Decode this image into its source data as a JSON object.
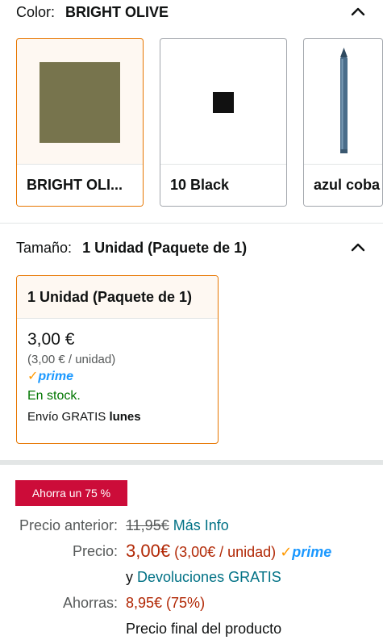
{
  "color_section": {
    "label": "Color:",
    "selected_value": "BRIGHT OLIVE",
    "swatches": [
      {
        "name": "BRIGHT OLI...",
        "color": "#77744d"
      },
      {
        "name": "10 Black",
        "color": "#111111"
      },
      {
        "name": "azul coba",
        "color": "#4a6d8a"
      }
    ]
  },
  "size_section": {
    "label": "Tamaño:",
    "selected_value": "1 Unidad (Paquete de 1)",
    "card": {
      "title": "1 Unidad (Paquete de 1)",
      "price": "3,00 €",
      "unit_price": "(3,00 € / unidad)",
      "prime": "prime",
      "stock": "En stock.",
      "shipping_prefix": "Envío GRATIS",
      "shipping_day": "lunes"
    }
  },
  "deal_badge": "Ahorra un 75 %",
  "pricing": {
    "previous_label": "Precio anterior:",
    "previous_price": "11,95€",
    "more_info": "Más Info",
    "price_label": "Precio:",
    "price": "3,00€",
    "price_unit": "(3,00€ / unidad)",
    "prime": "prime",
    "returns_prefix": "y",
    "returns_link": "Devoluciones GRATIS",
    "savings_label": "Ahorras:",
    "savings": "8,95€ (75%)",
    "final_note": "Precio final del producto"
  },
  "colors": {
    "accent": "#e77600",
    "link": "#007185",
    "price_red": "#b12704",
    "stock_green": "#007600",
    "badge_red": "#cc0c39",
    "prime_blue": "#1a98ff"
  }
}
